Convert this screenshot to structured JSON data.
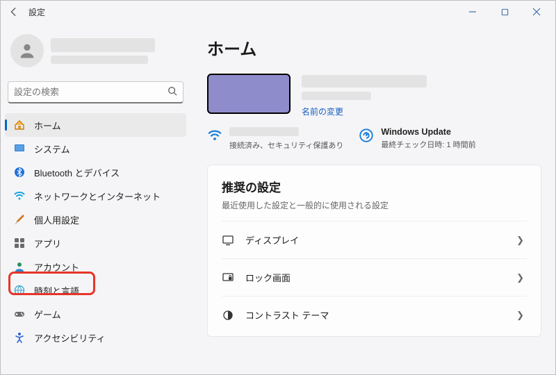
{
  "window": {
    "title": "設定"
  },
  "search": {
    "placeholder": "設定の検索"
  },
  "sidebar": {
    "items": [
      {
        "label": "ホーム"
      },
      {
        "label": "システム"
      },
      {
        "label": "Bluetooth とデバイス"
      },
      {
        "label": "ネットワークとインターネット"
      },
      {
        "label": "個人用設定"
      },
      {
        "label": "アプリ"
      },
      {
        "label": "アカウント"
      },
      {
        "label": "時刻と言語"
      },
      {
        "label": "ゲーム"
      },
      {
        "label": "アクセシビリティ"
      }
    ]
  },
  "main": {
    "heading": "ホーム",
    "rename_link": "名前の変更",
    "wifi": {
      "status": "接続済み、セキュリティ保護あり"
    },
    "update": {
      "title": "Windows Update",
      "status": "最終チェック日時: 1 時間前"
    },
    "recommended": {
      "title": "推奨の設定",
      "subtitle": "最近使用した設定と一般的に使用される設定",
      "items": [
        {
          "label": "ディスプレイ"
        },
        {
          "label": "ロック画面"
        },
        {
          "label": "コントラスト テーマ"
        }
      ]
    }
  }
}
